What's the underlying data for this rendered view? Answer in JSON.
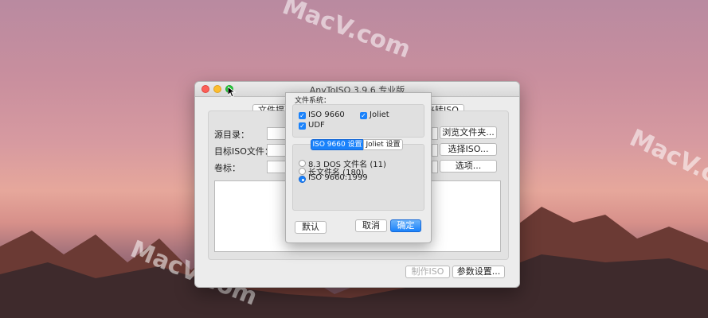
{
  "window": {
    "title": "AnyToISO 3.9.6 专业版",
    "tab_extract_partial": "文件提取",
    "tab_convert_partial": "夹转ISO",
    "source_label": "源目录：",
    "target_label": "目标ISO文件：",
    "volume_label": "卷标：",
    "browse_folder_button": "浏览文件夹...",
    "select_iso_button": "选择ISO...",
    "options_button": "选项...",
    "make_iso_button": "制作ISO",
    "settings_button": "参数设置..."
  },
  "sheet": {
    "filesystem_label": "文件系统：",
    "iso9660_label": "ISO 9660",
    "iso9660_checked": true,
    "joliet_label": "Joliet",
    "joliet_checked": true,
    "udf_label": "UDF",
    "udf_checked": true,
    "seg_iso_label": "ISO 9660 设置",
    "seg_joliet_label": "Joliet 设置",
    "radio_83_label": "8.3 DOS 文件名 (11)",
    "radio_long_label": "长文件名 (180)",
    "radio_1999_label": "ISO 9660:1999",
    "selected_radio": "ISO 9660:1999",
    "default_button": "默认",
    "cancel_button": "取消",
    "ok_button": "确定"
  },
  "desktop": {
    "watermark": "MacV.com"
  },
  "colors": {
    "accent": "#1a82fb",
    "close": "#fc5f57",
    "minimize": "#fdbd2e",
    "maximize": "#28c840"
  }
}
